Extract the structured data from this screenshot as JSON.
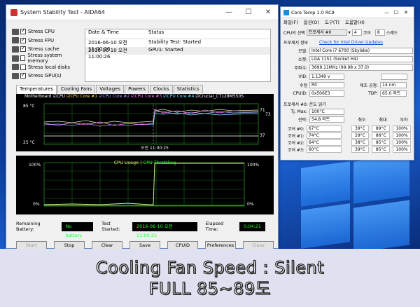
{
  "aida": {
    "title": "System Stability Test - AIDA64",
    "stress_items": [
      {
        "label": "Stress CPU",
        "checked": true
      },
      {
        "label": "Stress FPU",
        "checked": true
      },
      {
        "label": "Stress cache",
        "checked": true
      },
      {
        "label": "Stress system memory",
        "checked": false
      },
      {
        "label": "Stress local disks",
        "checked": false
      },
      {
        "label": "Stress GPU(s)",
        "checked": true
      }
    ],
    "log": {
      "col_date": "Date & Time",
      "col_status": "Status",
      "rows": [
        {
          "date": "2016-06-10 오전 11:00:26",
          "status": "Stability Test: Started"
        },
        {
          "date": "2016-06-10 오전 11:00:26",
          "status": "GPU1: Started"
        }
      ]
    },
    "tabs": [
      "Temperatures",
      "Cooling Fans",
      "Voltages",
      "Powers",
      "Clocks",
      "Statistics"
    ],
    "temp_graph": {
      "legend": [
        "Motherboard",
        "CPU",
        "CPU Core #1",
        "CPU Core #2",
        "CPU Core #3",
        "CPU Core #4",
        "Crucial_CT128M550S"
      ],
      "y_top": "85 °C",
      "y_bottom": "25 °C",
      "val1": "71",
      "val1b": "73",
      "val2": "37",
      "time": "오전 11:00:25"
    },
    "usage_graph": {
      "title_usage": "CPU Usage",
      "title_sep": "|",
      "title_throttle": "CPU Throttling",
      "y_top_left": "100%",
      "y_bottom_left": "0%",
      "y_top_right": "100%",
      "y_bottom_right": "0%"
    },
    "status": {
      "battery_label": "Remaining Battery:",
      "battery_value": "No battery",
      "started_label": "Test Started:",
      "started_value": "2016-06-10 오전 11:00:25",
      "elapsed_label": "Elapsed Time:",
      "elapsed_value": "0:04:21"
    },
    "buttons": {
      "start": "Start",
      "stop": "Stop",
      "clear": "Clear",
      "save": "Save",
      "cpuid": "CPUID",
      "preferences": "Preferences",
      "close": "Close"
    }
  },
  "coretemp": {
    "title": "Core Temp 1.0 RC9",
    "menu": [
      "파일(F)",
      "옵션(O)",
      "도구(T)",
      "도움말(H)"
    ],
    "cpu_select_label": "CPU의 선택",
    "cpu_select_value": "프로세서 #0",
    "cores_count": "4",
    "cores_label": "코어",
    "threads_count": "8",
    "threads_label": "스레드",
    "info_label": "프로세서 정보",
    "driver_link": "Check for Intel Driver Updates",
    "model_label": "모델:",
    "model_value": "Intel Core i7 6700 (Skylake)",
    "socket_label": "소켓:",
    "socket_value": "LGA 1151 (Socket H4)",
    "freq_label": "주파수:",
    "freq_value": "3699.11MHz (99.98 x 37.0)",
    "vid_label": "VID:",
    "vid_value": "1.1349 v",
    "mod_label": "수정",
    "mod_value": "R0",
    "lith_label": "제조 공정:",
    "lith_value": "14 nm",
    "cpuid_label": "CPUID:",
    "cpuid_value": "0x506E3",
    "tdp_label": "TDP:",
    "tdp_value": "65.0 와트",
    "temp_section": "프로세서 #0: 온도 읽기",
    "tjmax_label": "Tj. Max:",
    "tjmax_value": "100°C",
    "power_label": "전력:",
    "power_value": "54.8 와트",
    "col_min": "최소",
    "col_max": "최대",
    "col_load": "부하",
    "cores": [
      {
        "name": "코어 #0:",
        "temp": "67°C",
        "min": "39°C",
        "max": "89°C",
        "load": "100%"
      },
      {
        "name": "코어 #1:",
        "temp": "74°C",
        "min": "29°C",
        "max": "86°C",
        "load": "100%"
      },
      {
        "name": "코어 #2:",
        "temp": "64°C",
        "min": "38°C",
        "max": "85°C",
        "load": "100%"
      },
      {
        "name": "코어 #3:",
        "temp": "60°C",
        "min": "39°C",
        "max": "85°C",
        "load": "100%"
      }
    ]
  },
  "caption": {
    "line1": "Cooling Fan Speed : Silent",
    "line2": "FULL 85~89도"
  }
}
